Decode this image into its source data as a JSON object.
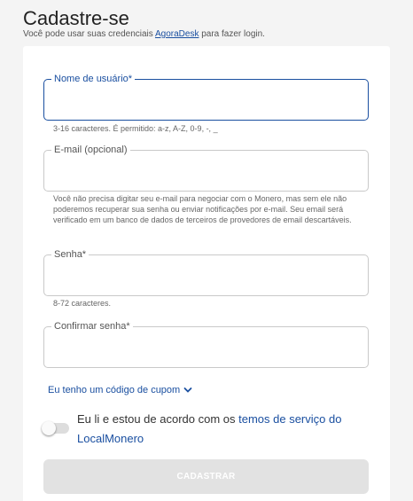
{
  "header": {
    "title": "Cadastre-se",
    "subtitle_before": "Você pode usar suas credenciais ",
    "subtitle_link": "AgoraDesk",
    "subtitle_after": " para fazer login."
  },
  "form": {
    "username": {
      "label": "Nome de usuário*",
      "value": "",
      "help": "3-16 caracteres. É permitido: a-z, A-Z, 0-9, -, _"
    },
    "email": {
      "label": "E-mail (opcional)",
      "value": "",
      "help": "Você não precisa digitar seu e-mail para negociar com o Monero, mas sem ele não poderemos recuperar sua senha ou enviar notificações por e-mail. Seu email será verificado em um banco de dados de terceiros de provedores de email descartáveis."
    },
    "password": {
      "label": "Senha*",
      "value": "",
      "help": "8-72 caracteres."
    },
    "confirm_password": {
      "label": "Confirmar senha*",
      "value": ""
    },
    "coupon_link": "Eu tenho um código de cupom",
    "terms": {
      "text_before": "Eu li e estou de acordo com os ",
      "link": "temos de serviço do LocalMonero",
      "accepted": false
    },
    "submit_label": "CADASTRAR"
  },
  "colors": {
    "accent": "#1a4fa0",
    "disabled_button": "#e2e2e2",
    "background": "#f4f4f4"
  },
  "icons": {
    "coupon_toggle": "chevron-down-icon"
  }
}
